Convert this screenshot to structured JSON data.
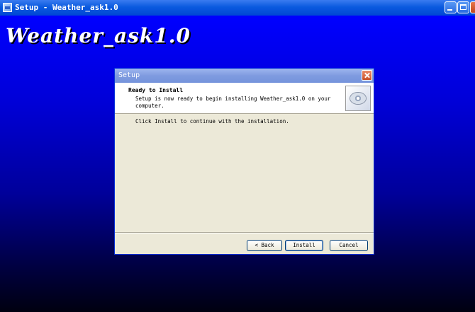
{
  "window": {
    "title": "Setup - Weather_ask1.0",
    "icon": "setup-app-icon"
  },
  "banner": {
    "title": "Weather_ask1.0"
  },
  "dialog": {
    "title": "Setup",
    "heading": "Ready to Install",
    "subtext": "Setup is now ready to begin installing Weather_ask1.0 on your computer.",
    "body": "Click Install to continue with the installation.",
    "icon": "cd-disc-icon",
    "buttons": {
      "back": "< Back",
      "install": "Install",
      "cancel": "Cancel"
    }
  },
  "colors": {
    "titlebar": "#0a5adf",
    "background_top": "#0000ff",
    "background_bottom": "#000010",
    "dialog_face": "#ece9d8"
  }
}
